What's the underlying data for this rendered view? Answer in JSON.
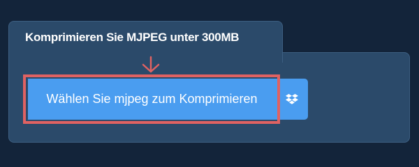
{
  "heading": {
    "title": "Komprimieren Sie MJPEG unter 300MB"
  },
  "uploader": {
    "choose_file_label": "Wählen Sie mjpeg zum Komprimieren",
    "dropbox_icon": "dropbox-icon"
  },
  "colors": {
    "page_background": "#13243a",
    "panel_background": "#2b4a6a",
    "button_background": "#4a9df0",
    "highlight": "#e06262"
  }
}
